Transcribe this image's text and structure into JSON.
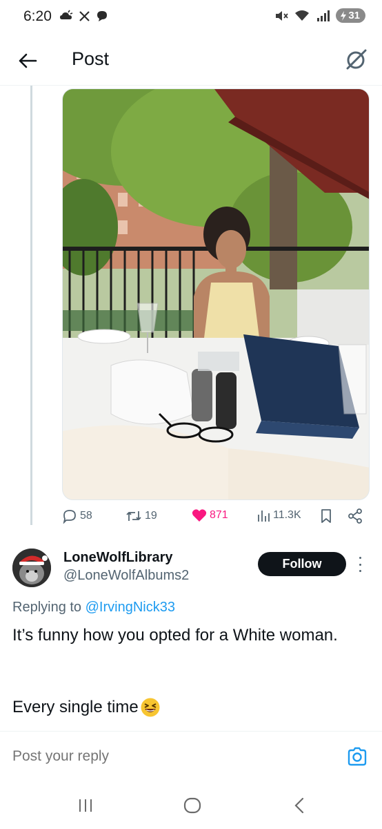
{
  "status_bar": {
    "time": "6:20",
    "battery": "31"
  },
  "header": {
    "title": "Post"
  },
  "post": {
    "image_alt": "Woman seated at a restaurant table on an outdoor terrace with menus and tableware",
    "actions": {
      "replies": "58",
      "reposts": "19",
      "likes": "871",
      "views": "11.3K"
    }
  },
  "reply": {
    "display_name": "LoneWolfLibrary",
    "handle": "@LoneWolfAlbums2",
    "follow_label": "Follow",
    "replying_prefix": "Replying to ",
    "replying_to": "@IrvingNick33",
    "text_line1": "It’s funny how you opted for a White woman.",
    "text_line2": "Every single time"
  },
  "compose": {
    "placeholder": "Post your reply"
  },
  "colors": {
    "accent": "#1d9bf0",
    "like": "#f91880",
    "text_primary": "#0f1419",
    "text_secondary": "#536471"
  }
}
